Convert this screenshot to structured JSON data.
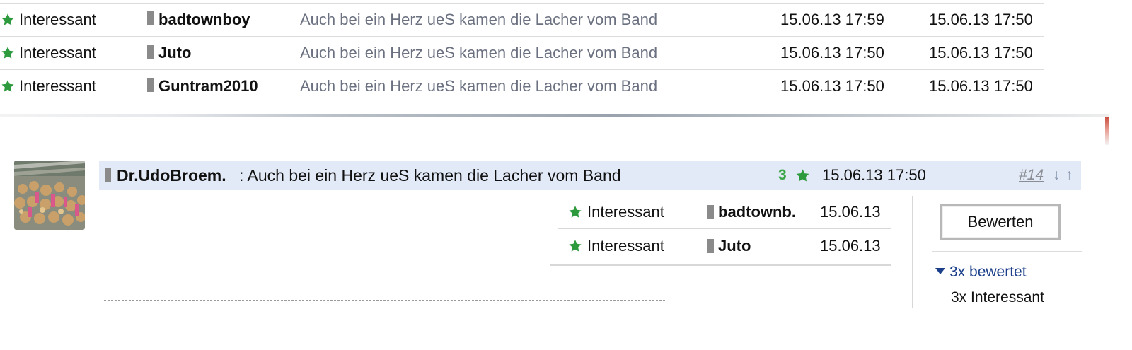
{
  "colors": {
    "star_green": "#2e9a3e",
    "count_green": "#3aa648",
    "header_bg": "#e3eaf7",
    "link_blue": "#1b3f8a",
    "muted_title": "#6b7180"
  },
  "ratings_table": [
    {
      "icon": "star-icon",
      "rating": "Interessant",
      "user": "badtownboy",
      "title": "Auch bei ein Herz ueS kamen die Lacher vom Band",
      "date1": "15.06.13 17:59",
      "date2": "15.06.13 17:50"
    },
    {
      "icon": "star-icon",
      "rating": "Interessant",
      "user": "Juto",
      "title": "Auch bei ein Herz ueS kamen die Lacher vom Band",
      "date1": "15.06.13 17:50",
      "date2": "15.06.13 17:50"
    },
    {
      "icon": "star-icon",
      "rating": "Interessant",
      "user": "Guntram2010",
      "title": "Auch bei ein Herz ueS kamen die Lacher vom Band",
      "date1": "15.06.13 17:50",
      "date2": "15.06.13 17:50"
    }
  ],
  "post": {
    "user": "Dr.UdoBroem.",
    "title": ": Auch bei ein Herz ueS kamen die Lacher vom Band",
    "rating_count": "3",
    "date": "15.06.13 17:50",
    "post_number": "#14",
    "down_arrow": "↓",
    "up_arrow": "↑",
    "ratings": [
      {
        "rating": "Interessant",
        "user": "badtownb.",
        "date": "15.06.13"
      },
      {
        "rating": "Interessant",
        "user": "Juto",
        "date": "15.06.13"
      }
    ],
    "rate_button_label": "Bewerten",
    "rated_summary": "3x bewertet",
    "rated_detail": "3x Interessant"
  }
}
